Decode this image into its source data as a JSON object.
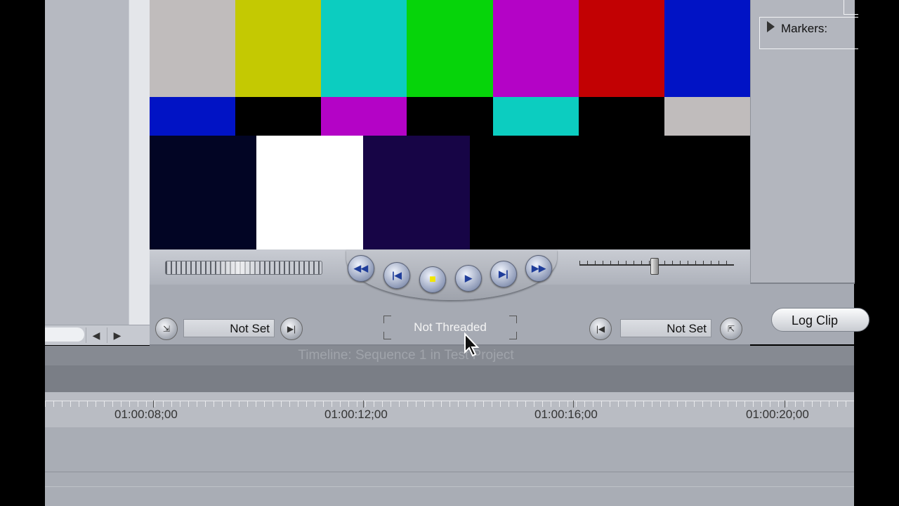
{
  "viewer": {
    "top_bars": [
      "#c0bcbc",
      "#c4c902",
      "#0ccdc0",
      "#06d40a",
      "#b403c6",
      "#c20103",
      "#0113c5"
    ],
    "mid_bars": [
      "#0113c5",
      "#000000",
      "#b403c6",
      "#000000",
      "#0ccdc0",
      "#000000",
      "#c0bcbc"
    ],
    "bottom_bars": [
      "#020524",
      "#ffffff",
      "#170546",
      "#000000",
      "#000000",
      "#000000"
    ]
  },
  "transport": {
    "buttons": [
      {
        "name": "rewind-icon",
        "glyph": "◀◀"
      },
      {
        "name": "prev-edit-icon",
        "glyph": "|◀"
      },
      {
        "name": "stop-icon",
        "glyph": "■"
      },
      {
        "name": "play-icon",
        "glyph": "▶"
      },
      {
        "name": "next-edit-icon",
        "glyph": "▶|"
      },
      {
        "name": "fast-forward-icon",
        "glyph": "▶▶"
      }
    ]
  },
  "controls": {
    "in_point": "Not Set",
    "out_point": "Not Set",
    "capture_mode": "Not Threaded",
    "log_clip_label": "Log Clip"
  },
  "right_panel": {
    "markers_label": "Markers:"
  },
  "timeline": {
    "title": "Timeline: Sequence 1 in Test Project",
    "ruler_labels": [
      "01:00:08;00",
      "01:00:12;00",
      "01:00:16;00",
      "01:00:20;00"
    ]
  },
  "icons": {
    "scroll_left": "◀",
    "scroll_right": "▶",
    "mark_in": "⇲",
    "go_in": "▶|",
    "go_out": "|◀",
    "mark_out": "⇱"
  }
}
